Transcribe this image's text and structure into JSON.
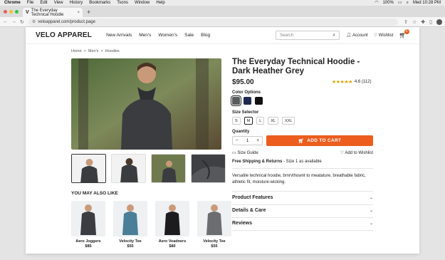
{
  "menubar": {
    "app": "Chrome",
    "items": [
      "File",
      "Edit",
      "View",
      "History",
      "Bookmarks",
      "Tsons",
      "Window",
      "Help"
    ],
    "battery": "100%",
    "datetime": "Med 10:28 PM"
  },
  "browser": {
    "tab_title": "The Everyday Technical Hoodie",
    "tab_logo": "V",
    "url": "veloapparel.com/product.page"
  },
  "site": {
    "logo": "VELO APPAREL",
    "nav": [
      "New Arrivals",
      "Men's",
      "Women's",
      "Sale",
      "Blog"
    ],
    "search_placeholder": "Search",
    "account": "Account",
    "wishlist": "Wishlist",
    "cart_count": "0"
  },
  "breadcrumb": [
    "Home",
    "Men's",
    "Hoodies"
  ],
  "product": {
    "title": "The Everyday Technical Hoodie - Dark Heather Grey",
    "price": "$95.00",
    "rating": "4.6 (112)",
    "rating_value": 4.6,
    "color_label": "Color Options",
    "colors": [
      "#5a5b5e",
      "#1e2a4d",
      "#111111"
    ],
    "selected_color": 0,
    "size_label": "Size Selector",
    "sizes": [
      "S",
      "M",
      "L",
      "XL",
      "XXL"
    ],
    "selected_size": 1,
    "qty_label": "Quantity",
    "qty": "1",
    "qty_minus": "−",
    "qty_plus": "+",
    "add_to_cart": "ADD TO CART",
    "size_guide": "Size Guide",
    "add_to_wishlist": "Add to Wishlist",
    "shipping_bold": "Free Shipping & Returns",
    "shipping_rest": " - Size 1 as available",
    "description": "Versatile technical hoodie, brnrvthownt to meatature, breathable fabric, athletic fit, moisture-wicking."
  },
  "accordion": [
    "Product Features",
    "Details & Care",
    "Reviews"
  ],
  "recs": {
    "title": "YOU MAY ALSO LIKE",
    "items": [
      {
        "name": "Aero Joggers",
        "price": "$85",
        "color": "#3b3d42"
      },
      {
        "name": "Velocity Tee",
        "price": "$55",
        "color": "#4a7f97"
      },
      {
        "name": "Aero Veadners",
        "price": "$80",
        "color": "#1c1c1e"
      },
      {
        "name": "Velocity Tee",
        "price": "$55",
        "color": "#6b6d70"
      }
    ]
  }
}
